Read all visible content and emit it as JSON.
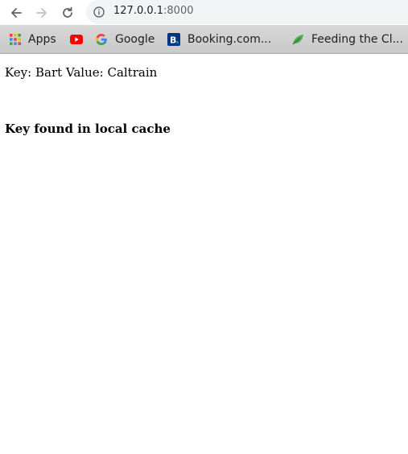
{
  "browser": {
    "url_host": "127.0.0.1",
    "url_port": ":8000",
    "bookmarks": [
      {
        "label": "Apps",
        "icon": "apps-grid-icon"
      },
      {
        "label": "",
        "icon": "youtube-icon"
      },
      {
        "label": "Google",
        "icon": "google-icon"
      },
      {
        "label": "Booking.com...",
        "icon": "booking-icon"
      },
      {
        "label": "Feeding the Cl...",
        "icon": "leaf-icon"
      }
    ]
  },
  "page": {
    "key_value_text": "Key: Bart Value: Caltrain",
    "status_text": "Key found in local cache"
  },
  "colors": {
    "omnibox_bg": "#f1f3f4",
    "bookmarks_bar_bg": "#d0d0d0",
    "youtube_red": "#ff0000",
    "booking_blue": "#003580",
    "leaf_green": "#4caf50"
  }
}
